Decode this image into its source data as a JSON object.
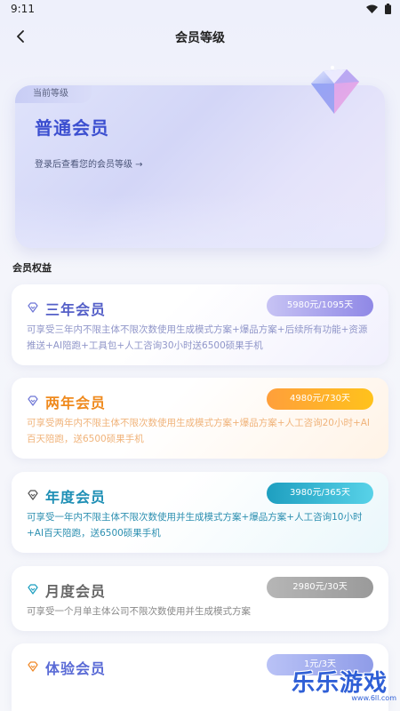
{
  "status": {
    "time": "9:11"
  },
  "nav": {
    "title": "会员等级"
  },
  "level": {
    "current_tag": "当前等级",
    "name": "普通会员",
    "login_link": "登录后查看您的会员等级 →"
  },
  "benefits": {
    "section_title": "会员权益",
    "tiers": [
      {
        "name": "三年会员",
        "price": "5980元/1095天",
        "desc": "可享受三年内不限主体不限次数使用生成模式方案+爆品方案+后续所有功能+资源推送+AI陪跑+工具包+人工咨询30小时送6500硕果手机"
      },
      {
        "name": "两年会员",
        "price": "4980元/730天",
        "desc": "可享受两年内不限主体不限次数使用生成模式方案+爆品方案+人工咨询20小时+AI百天陪跑，送6500硕果手机"
      },
      {
        "name": "年度会员",
        "price": "3980元/365天",
        "desc": "可享受一年内不限主体不限次数使用并生成模式方案+爆品方案+人工咨询10小时+AI百天陪跑，送6500硕果手机"
      },
      {
        "name": "月度会员",
        "price": "2980元/30天",
        "desc": "可享受一个月单主体公司不限次数使用并生成模式方案"
      },
      {
        "name": "体验会员",
        "price": "1元/3天"
      }
    ]
  },
  "watermark": {
    "text": "乐乐游戏",
    "url": "www.6ll.com"
  },
  "colors": {
    "accent": "#3c4fd0",
    "orange": "#ef8a1e",
    "cyan": "#1e8fb5"
  }
}
